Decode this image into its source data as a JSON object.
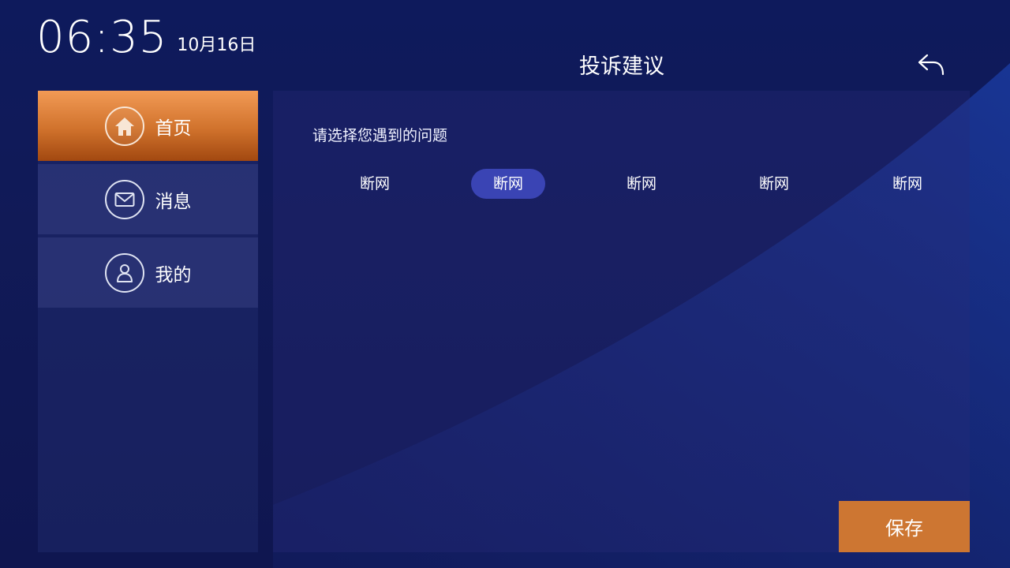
{
  "clock": {
    "time": "06:35",
    "date": "10月16日"
  },
  "header": {
    "title": "投诉建议",
    "back_icon": "back-arrow-icon"
  },
  "sidebar": {
    "items": [
      {
        "label": "首页",
        "icon": "home-icon",
        "active": true
      },
      {
        "label": "消息",
        "icon": "mail-icon",
        "active": false
      },
      {
        "label": "我的",
        "icon": "user-icon",
        "active": false
      }
    ]
  },
  "main": {
    "prompt": "请选择您遇到的问题",
    "options": [
      {
        "label": "断网",
        "selected": false
      },
      {
        "label": "断网",
        "selected": true
      },
      {
        "label": "断网",
        "selected": false
      },
      {
        "label": "断网",
        "selected": false
      },
      {
        "label": "断网",
        "selected": false
      }
    ],
    "save_label": "保存"
  },
  "colors": {
    "accent": "#cd7632",
    "selected_option": "#3a44b4",
    "background": "#0e1a5c"
  }
}
